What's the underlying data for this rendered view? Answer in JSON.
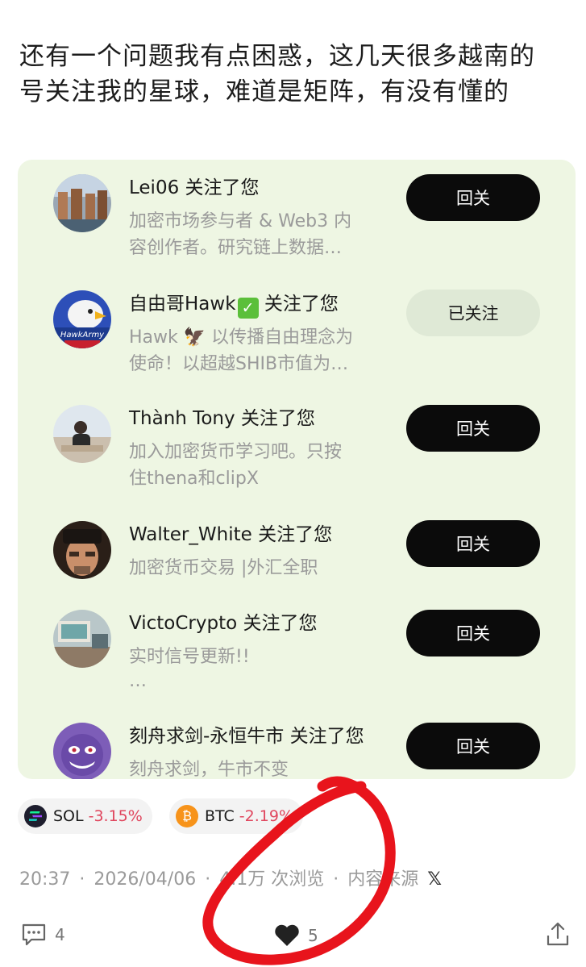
{
  "post": {
    "line1": "还有一个问题我有点困惑，这几天很多越南的",
    "line2": "号关注我的星球，难道是矩阵，有没有懂的"
  },
  "followers": [
    {
      "name": "Lei06 关注了您",
      "desc1": "加密市场参与者 & Web3 内",
      "desc2": "容创作者。研究链上数据…",
      "button": "回关",
      "followed": false
    },
    {
      "name": "自由哥Hawk",
      "name_suffix": " 关注了您",
      "desc1": "Hawk 🦅 以传播自由理念为",
      "desc2": "使命！以超越SHIB市值为…",
      "button": "已关注",
      "followed": true
    },
    {
      "name": "Thành Tony 关注了您",
      "desc1": "加入加密货币学习吧。只按",
      "desc2": "住thena和clipX",
      "button": "回关",
      "followed": false
    },
    {
      "name": "Walter_White 关注了您",
      "desc1": "加密货币交易 |外汇全职",
      "desc2": "",
      "button": "回关",
      "followed": false
    },
    {
      "name": "VictoCrypto 关注了您",
      "desc1": "实时信号更新!!",
      "desc2": "…",
      "button": "回关",
      "followed": false
    },
    {
      "name": "刻舟求剑-永恒牛市 关注了您",
      "desc1": "刻舟求剑，牛市不变",
      "desc2": "",
      "button": "回关",
      "followed": false
    }
  ],
  "avatar_texts": {
    "hawk": "HawkArmy"
  },
  "tags": [
    {
      "symbol": "SOL",
      "change": "-3.15%",
      "coin_color": "#1e1e2e"
    },
    {
      "symbol": "BTC",
      "change": "-2.19%",
      "coin_color": "#f7931a"
    }
  ],
  "meta": {
    "time": "20:37",
    "date": "2026/04/06",
    "views": "4.1万 次浏览",
    "source": "内容来源",
    "source_icon": "x-logo-icon"
  },
  "actions": {
    "comments": "4",
    "likes": "5"
  },
  "colors": {
    "card_bg": "#eef6e3",
    "button_bg": "#0b0b0b",
    "negative": "#e0465e",
    "annotation": "#e8141c"
  }
}
